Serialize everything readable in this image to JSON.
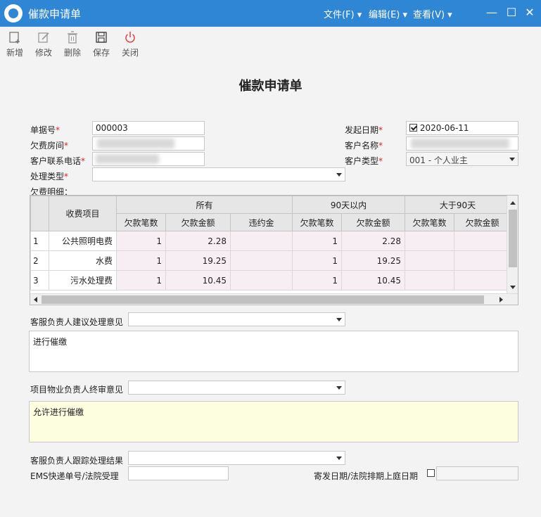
{
  "window": {
    "title": "催款申请单",
    "menus": [
      "文件(F)",
      "编辑(E)",
      "查看(V)"
    ]
  },
  "toolbar": {
    "new": "新增",
    "edit": "修改",
    "delete": "删除",
    "save": "保存",
    "close": "关闭"
  },
  "form": {
    "heading": "催款申请单",
    "doc_no_label": "单据号",
    "doc_no": "000003",
    "room_label": "欠费房间",
    "phone_label": "客户联系电话",
    "type_label": "处理类型",
    "type_value": "",
    "date_label": "发起日期",
    "date_value": "2020-06-11",
    "date_checked": true,
    "customer_name_label": "客户名称",
    "customer_type_label": "客户类型",
    "customer_type": "001 - 个人业主",
    "detail_label": "欠费明细：",
    "required_mark": "*"
  },
  "grid": {
    "col_item": "收费项目",
    "groups": [
      "所有",
      "90天以内",
      "大于90天"
    ],
    "sub_all": [
      "欠款笔数",
      "欠款金额",
      "违约金"
    ],
    "sub_90": [
      "欠款笔数",
      "欠款金额"
    ],
    "sub_gt90": [
      "欠款笔数",
      "欠款金额"
    ],
    "rows": [
      {
        "no": "1",
        "item": "公共照明电费",
        "cnt": "1",
        "amt": "2.28",
        "pen": "",
        "cnt90": "1",
        "amt90": "2.28",
        "cntg": "",
        "amtg": ""
      },
      {
        "no": "2",
        "item": "水费",
        "cnt": "1",
        "amt": "19.25",
        "pen": "",
        "cnt90": "1",
        "amt90": "19.25",
        "cntg": "",
        "amtg": ""
      },
      {
        "no": "3",
        "item": "污水处理费",
        "cnt": "1",
        "amt": "10.45",
        "pen": "",
        "cnt90": "1",
        "amt90": "10.45",
        "cntg": "",
        "amtg": ""
      }
    ]
  },
  "opinions": {
    "cs_label": "客服负责人建议处理意见",
    "cs_text": "进行催缴",
    "pm_label": "项目物业负责人终审意见",
    "pm_text": "允许进行催缴",
    "track_label": "客服负责人跟踪处理结果",
    "ems_label": "EMS快递单号/法院受理",
    "ems_value": "",
    "send_date_label": "寄发日期/法院排期上庭日期",
    "send_date_checked": false
  },
  "colors": {
    "titlebar": "#2f86d4",
    "row_highlight": "#f7eef3",
    "final_opinion_bg": "#fdfde0",
    "required": "#e02020"
  }
}
